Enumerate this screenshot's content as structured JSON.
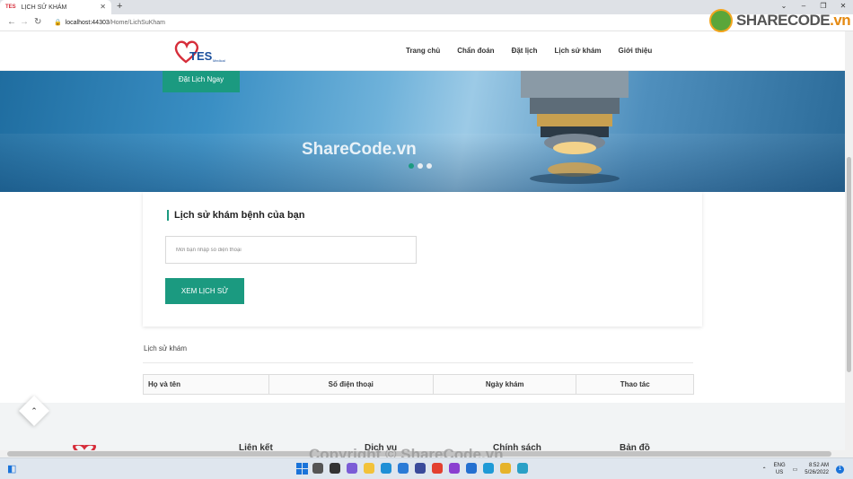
{
  "browser": {
    "tab_title": "LỊCH SỬ KHÁM",
    "tab_favicon": "TES",
    "url_host": "localhost:44303",
    "url_path": "/Home/LichSuKham"
  },
  "header": {
    "logo_text": "TES",
    "logo_sub": "Medical",
    "menu": [
      {
        "label": "Trang chủ"
      },
      {
        "label": "Chẩn đoán"
      },
      {
        "label": "Đặt lịch"
      },
      {
        "label": "Lịch sử khám"
      },
      {
        "label": "Giới thiệu"
      }
    ]
  },
  "hero": {
    "book_button": "Đặt Lịch Ngay",
    "slides": 3,
    "active_slide": 1
  },
  "lookup": {
    "title": "Lịch sử khám bệnh của bạn",
    "phone_placeholder": "Mời bạn nhập số điện thoại",
    "submit_label": "XEM LỊCH SỬ"
  },
  "history": {
    "section_label": "Lịch sử khám",
    "columns": [
      "Họ và tên",
      "Số điện thoại",
      "Ngày khám",
      "Thao tác"
    ]
  },
  "footer": {
    "columns": [
      "Liên kết",
      "Dịch vụ",
      "Chính sách",
      "Bản đồ"
    ]
  },
  "watermarks": {
    "logo": "SHARECODE",
    "logo_suffix": ".vn",
    "center": "ShareCode.vn",
    "bottom": "Copyright © ShareCode.vn"
  },
  "taskbar": {
    "lang_top": "ENG",
    "lang_bottom": "US",
    "time": "8:52 AM",
    "date": "5/26/2022"
  },
  "colors": {
    "accent": "#1b9a80",
    "brand_red": "#d62d3a"
  }
}
